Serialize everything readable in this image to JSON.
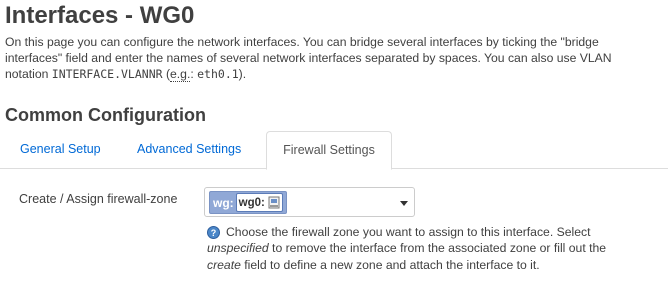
{
  "page": {
    "title": "Interfaces - WG0",
    "intro": {
      "line1": "On this page you can configure the network interfaces. You can bridge several interfaces by ticking the \"bridge",
      "line2": "interfaces\" field and enter the names of several network interfaces separated by spaces. You can also use VLAN",
      "line3_prefix": "notation",
      "line3_code1": "INTERFACE.VLANNR",
      "line3_open": "(",
      "line3_eg": "e.g.",
      "line3_colon": ":",
      "line3_code2": "eth0.1",
      "line3_close": ")."
    }
  },
  "section": {
    "title": "Common Configuration"
  },
  "tabs": [
    {
      "label": "General Setup",
      "active": false
    },
    {
      "label": "Advanced Settings",
      "active": false
    },
    {
      "label": "Firewall Settings",
      "active": true
    }
  ],
  "firewall": {
    "label": "Create / Assign firewall-zone",
    "zone_name": "wg:",
    "zone_interface": "wg0:",
    "help": {
      "line1": "Choose the firewall zone you want to assign to this interface. Select",
      "line2_em": "unspecified",
      "line2_rest": " to remove the interface from the associated zone or fill out the",
      "line3_em": "create",
      "line3_rest": " field to define a new zone and attach the interface to it."
    }
  },
  "colors": {
    "link": "#0069d6",
    "zone_badge": "#90a8d6",
    "help_icon": "#4a86c8"
  }
}
